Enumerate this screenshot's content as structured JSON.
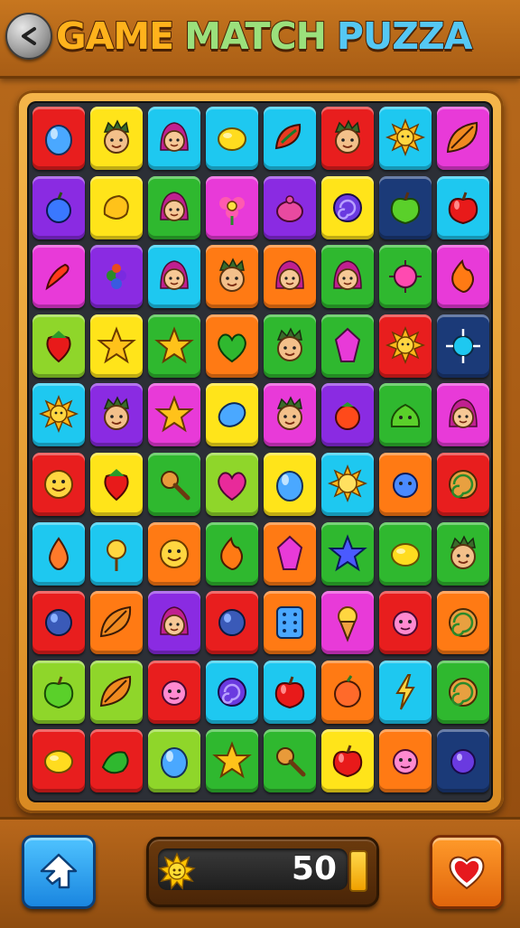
{
  "header": {
    "title_part1": "GAME",
    "title_part2": "MATCH",
    "title_part3": "PUZZA"
  },
  "colors": {
    "red": "#e81e1e",
    "yellow": "#ffe41a",
    "cyan": "#1ec8f0",
    "magenta": "#e83ad8",
    "purple": "#8a2be2",
    "green": "#2fb82f",
    "lime": "#8fd62a",
    "orange": "#ff7a14",
    "navy": "#1b3a78"
  },
  "board": {
    "rows": [
      [
        [
          "red",
          "blue-fruit"
        ],
        [
          "yellow",
          "boy-face"
        ],
        [
          "cyan",
          "girl-face"
        ],
        [
          "cyan",
          "lemon"
        ],
        [
          "cyan",
          "leaf-swirl"
        ],
        [
          "red",
          "boy-face"
        ],
        [
          "cyan",
          "sun"
        ],
        [
          "magenta",
          "leaf"
        ]
      ],
      [
        [
          "purple",
          "plum"
        ],
        [
          "yellow",
          "mango"
        ],
        [
          "green",
          "girl-face"
        ],
        [
          "magenta",
          "flower"
        ],
        [
          "purple",
          "berry"
        ],
        [
          "yellow",
          "swirl"
        ],
        [
          "navy",
          "green-apple"
        ],
        [
          "cyan",
          "apple"
        ]
      ],
      [
        [
          "magenta",
          "chili"
        ],
        [
          "purple",
          "grapes"
        ],
        [
          "cyan",
          "girl-face"
        ],
        [
          "orange",
          "boy-face"
        ],
        [
          "orange",
          "girl-face"
        ],
        [
          "green",
          "girl-face"
        ],
        [
          "green",
          "spiky-ball"
        ],
        [
          "magenta",
          "flame"
        ]
      ],
      [
        [
          "lime",
          "strawberry"
        ],
        [
          "yellow",
          "star"
        ],
        [
          "green",
          "star"
        ],
        [
          "orange",
          "heart-leaf"
        ],
        [
          "green",
          "boy-face"
        ],
        [
          "green",
          "crystal"
        ],
        [
          "red",
          "sun"
        ],
        [
          "navy",
          "spike-ball"
        ]
      ],
      [
        [
          "cyan",
          "sun"
        ],
        [
          "purple",
          "boy-face"
        ],
        [
          "magenta",
          "star"
        ],
        [
          "yellow",
          "blue-leaf"
        ],
        [
          "magenta",
          "boy-face"
        ],
        [
          "purple",
          "tomato"
        ],
        [
          "green",
          "slime"
        ],
        [
          "magenta",
          "girl-face"
        ]
      ],
      [
        [
          "red",
          "smiley"
        ],
        [
          "yellow",
          "strawberry"
        ],
        [
          "green",
          "mace"
        ],
        [
          "lime",
          "heart"
        ],
        [
          "yellow",
          "blue-fruit"
        ],
        [
          "cyan",
          "sun-face"
        ],
        [
          "orange",
          "blue-alien"
        ],
        [
          "red",
          "spiral"
        ]
      ],
      [
        [
          "cyan",
          "drop"
        ],
        [
          "cyan",
          "key-face"
        ],
        [
          "orange",
          "smiley"
        ],
        [
          "green",
          "flame"
        ],
        [
          "orange",
          "crystal"
        ],
        [
          "green",
          "blue-star"
        ],
        [
          "green",
          "lemon"
        ],
        [
          "green",
          "boy-face"
        ]
      ],
      [
        [
          "red",
          "blue-orb"
        ],
        [
          "orange",
          "leaf"
        ],
        [
          "purple",
          "girl-face"
        ],
        [
          "red",
          "blue-orb"
        ],
        [
          "orange",
          "dice"
        ],
        [
          "magenta",
          "ice-cream"
        ],
        [
          "red",
          "pink-face"
        ],
        [
          "orange",
          "spiral"
        ]
      ],
      [
        [
          "lime",
          "green-apple"
        ],
        [
          "lime",
          "leaf"
        ],
        [
          "red",
          "pink-face"
        ],
        [
          "cyan",
          "swirl"
        ],
        [
          "cyan",
          "apple"
        ],
        [
          "orange",
          "peach"
        ],
        [
          "cyan",
          "bolt"
        ],
        [
          "green",
          "spiral"
        ]
      ],
      [
        [
          "red",
          "lemon"
        ],
        [
          "red",
          "green-fish"
        ],
        [
          "lime",
          "blue-fruit"
        ],
        [
          "green",
          "star"
        ],
        [
          "green",
          "mace"
        ],
        [
          "yellow",
          "apple"
        ],
        [
          "orange",
          "pink-face"
        ],
        [
          "navy",
          "purple-orb"
        ]
      ]
    ]
  },
  "bottom": {
    "home_icon": "home-icon",
    "score_value": "50",
    "coin_icon": "sun-coin-icon",
    "heart_icon": "heart-icon",
    "progress": 0.1
  }
}
